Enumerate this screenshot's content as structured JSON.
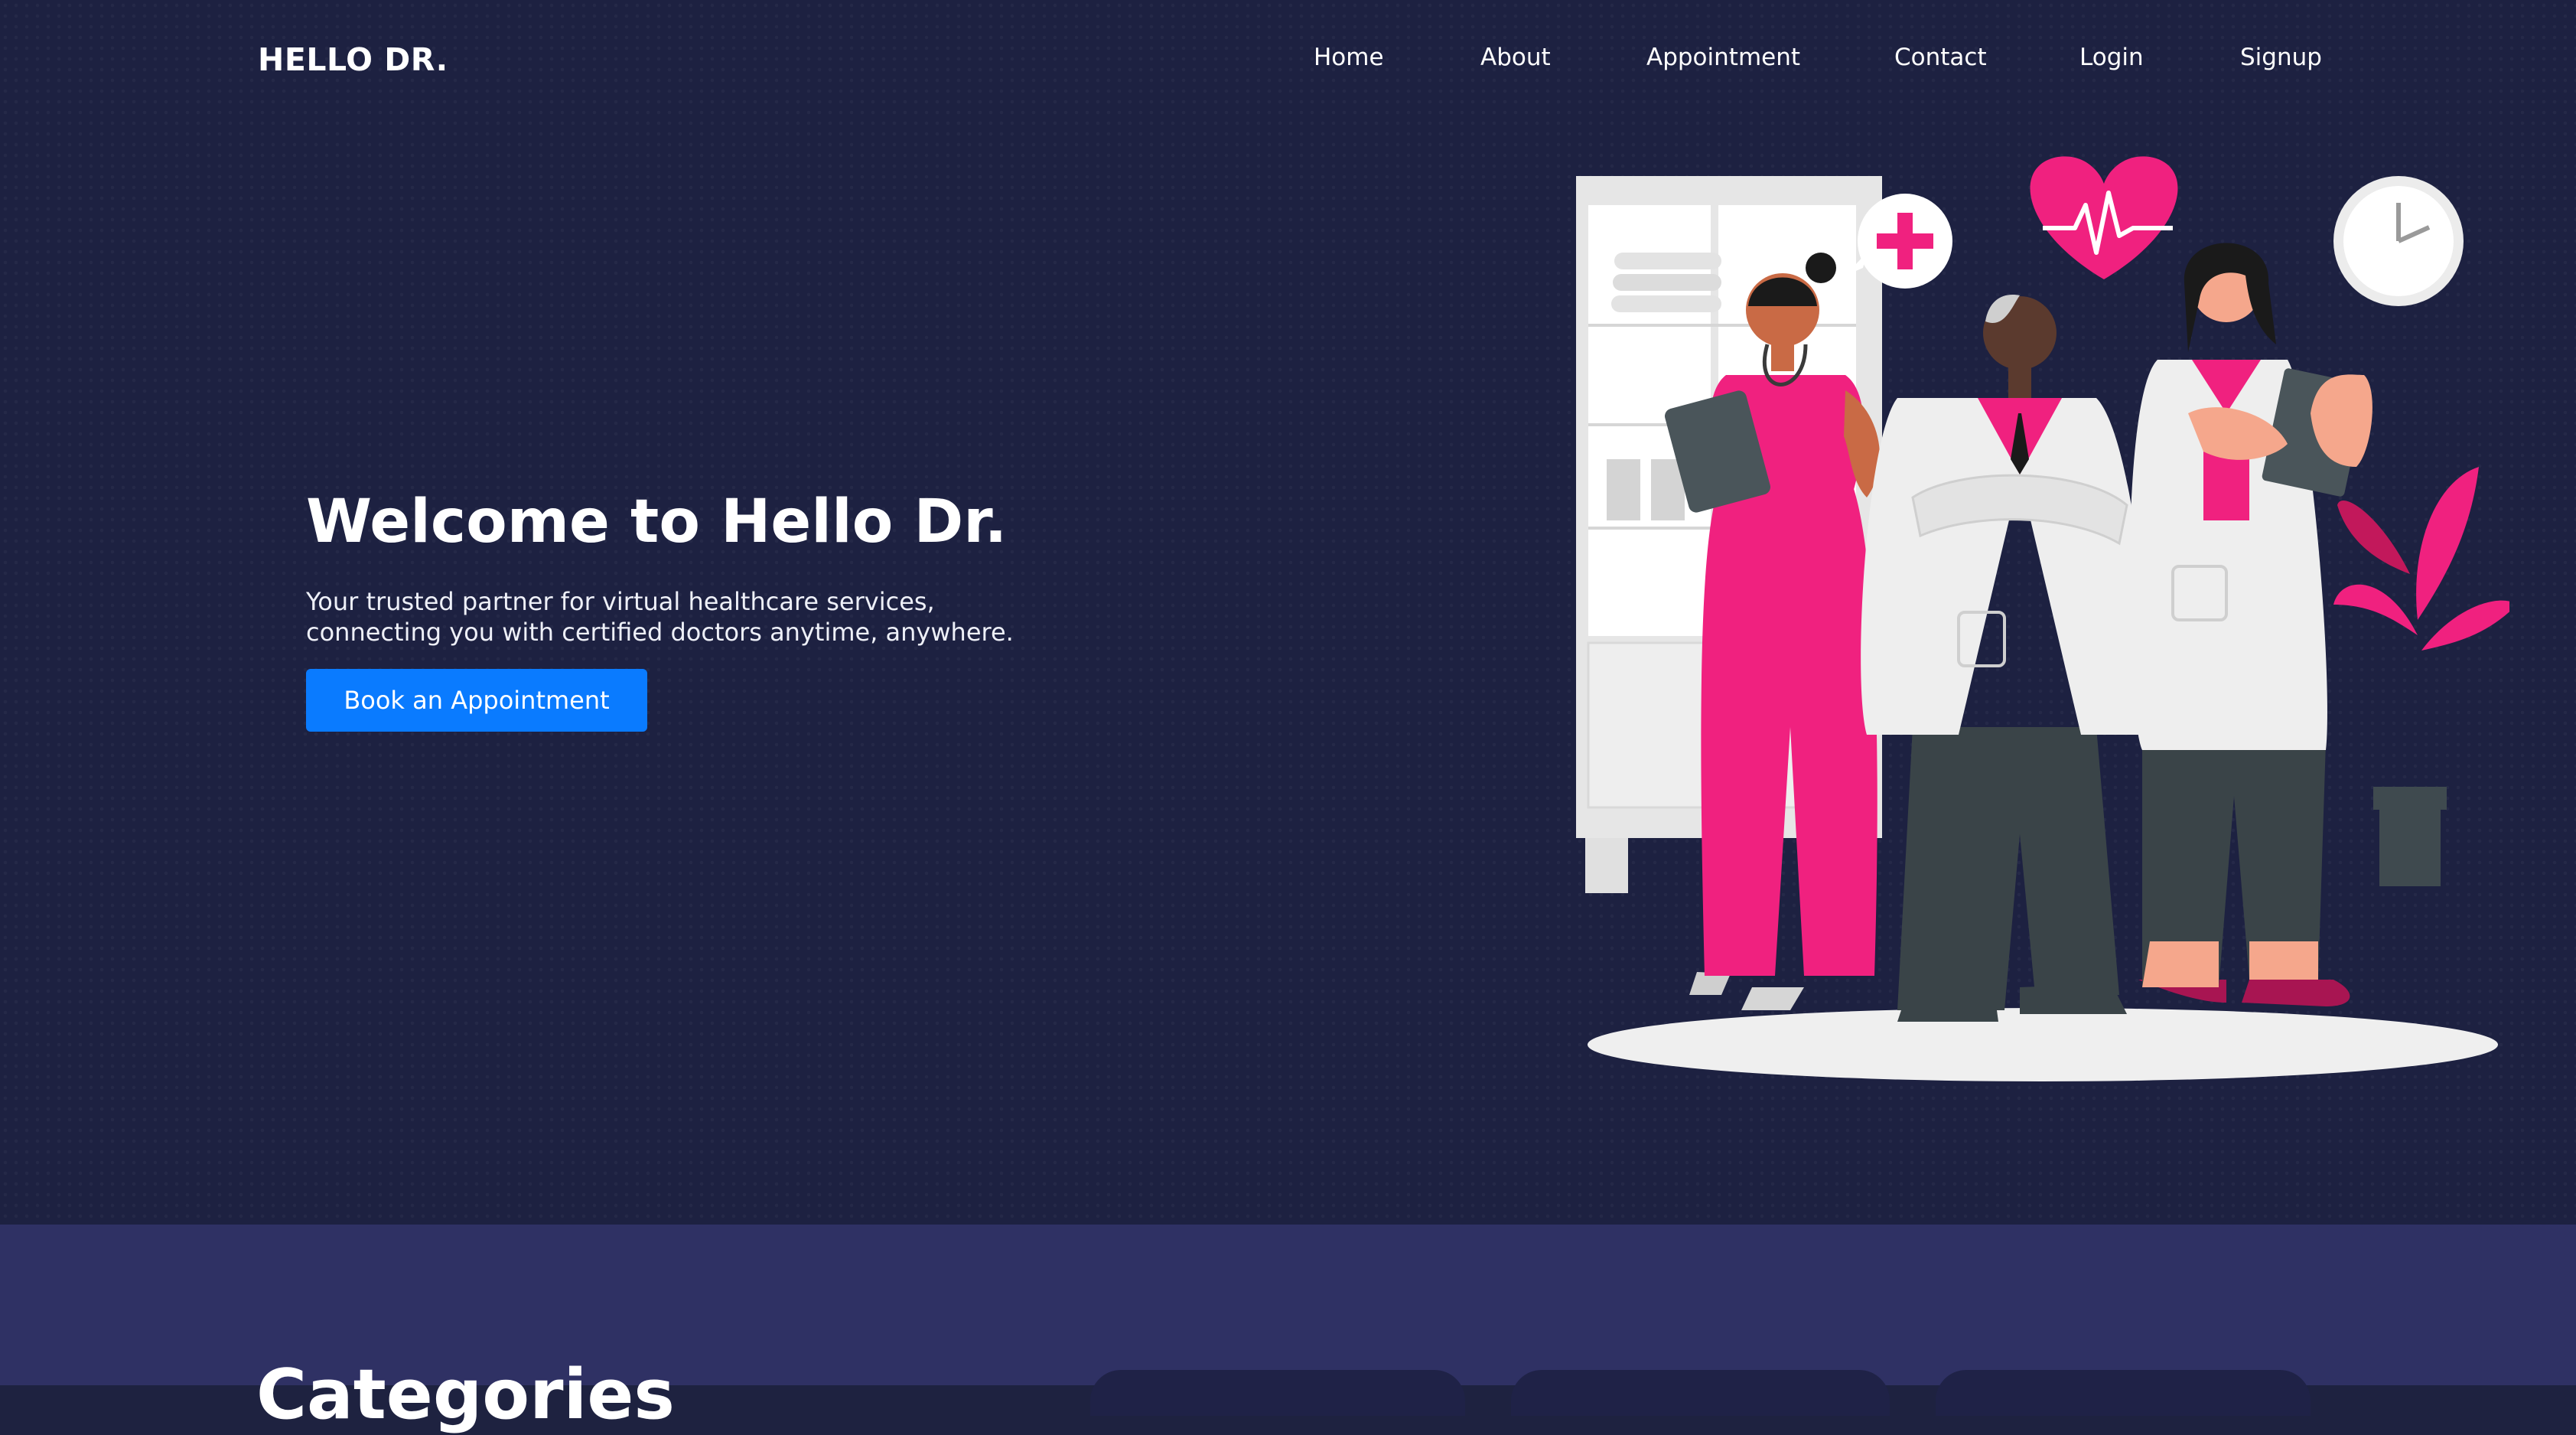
{
  "brand": "HELLO DR.",
  "nav": {
    "items": [
      {
        "label": "Home"
      },
      {
        "label": "About"
      },
      {
        "label": "Appointment"
      },
      {
        "label": "Contact"
      },
      {
        "label": "Login"
      },
      {
        "label": "Signup"
      }
    ]
  },
  "hero": {
    "title": "Welcome to Hello Dr.",
    "subtitle": "Your trusted partner for virtual healthcare services, connecting you with certified doctors anytime, anywhere.",
    "cta_label": "Book an Appointment"
  },
  "section2": {
    "title": "Categories"
  },
  "colors": {
    "hero_bg": "#1d2141",
    "section2_bg": "#2f3164",
    "cta": "#0a7bff",
    "accent_pink": "#f0217f",
    "white_coat": "#eeeeee",
    "dark_pants": "#3a4448"
  }
}
